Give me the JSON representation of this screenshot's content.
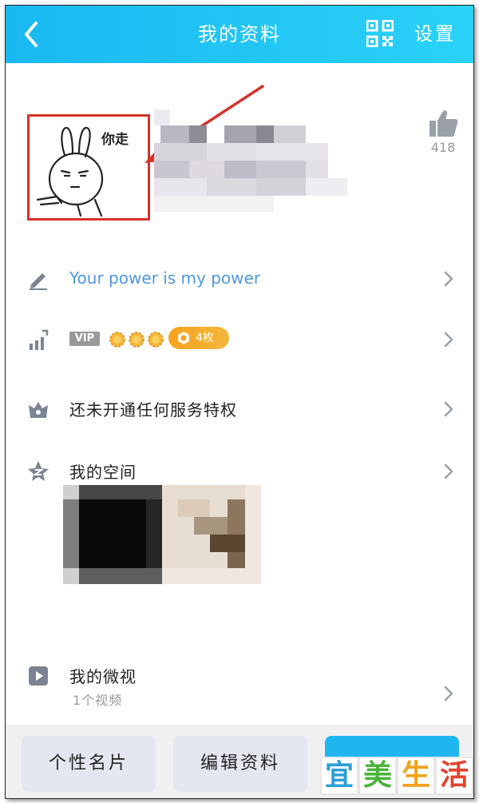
{
  "header": {
    "title": "我的资料",
    "settings_label": "设置"
  },
  "profile": {
    "avatar_caption": "你走",
    "like_count": "418"
  },
  "signature": {
    "text": "Your power is my power"
  },
  "level": {
    "vip_label": "VIP",
    "badge_count": "4枚"
  },
  "service": {
    "label": "还未开通任何服务特权"
  },
  "space": {
    "label": "我的空间"
  },
  "weishi": {
    "label": "我的微视",
    "sub": "1个视频"
  },
  "bottom": {
    "card_button": "个性名片",
    "edit_button": "编辑资料"
  },
  "watermark": {
    "chars": [
      "宜",
      "美",
      "生",
      "活"
    ]
  },
  "colors": {
    "header": "#19b8f2",
    "link": "#4f98e0",
    "annotation": "#d6322c",
    "badge": "#f8a21e"
  }
}
